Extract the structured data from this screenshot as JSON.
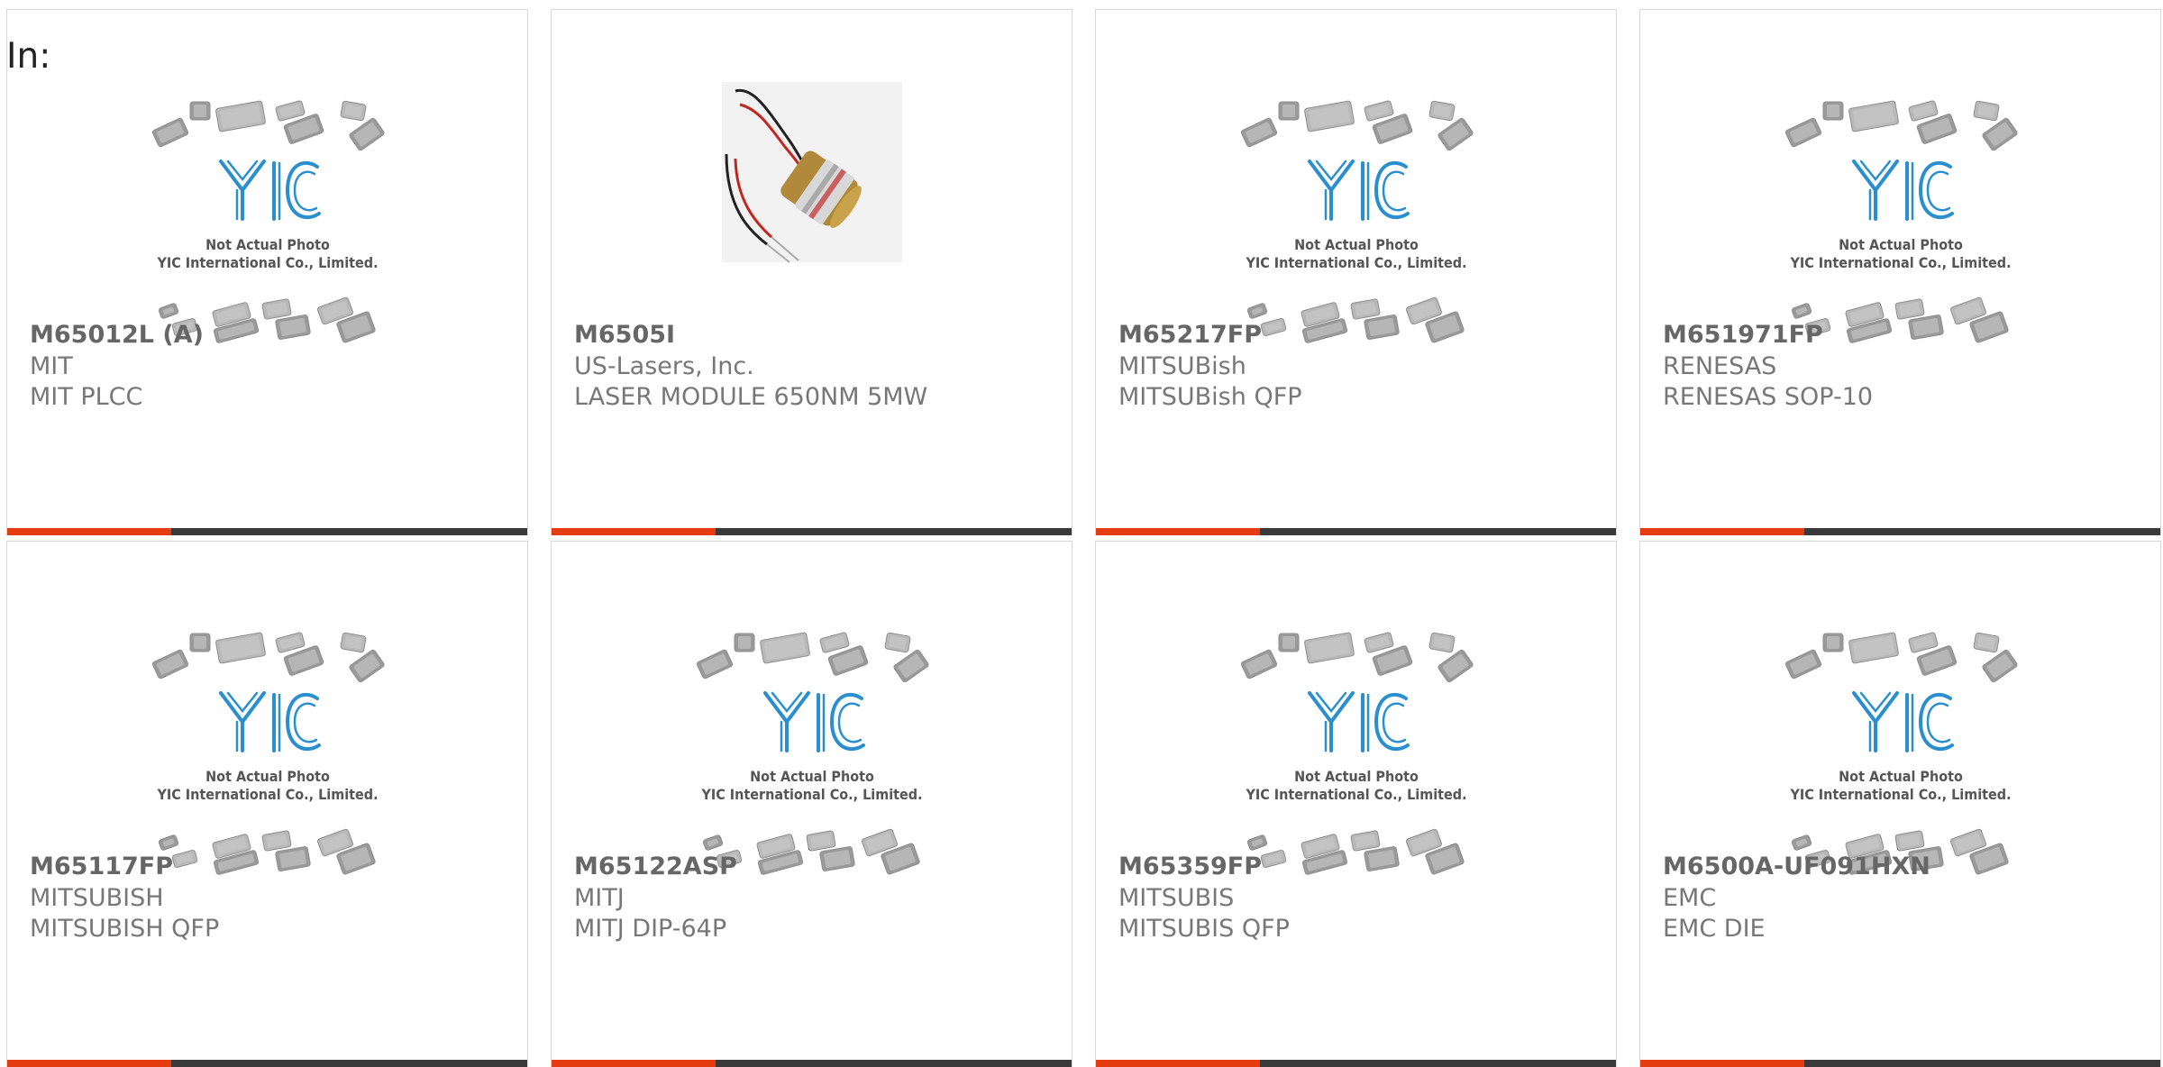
{
  "page": {
    "label": "In:"
  },
  "theme": {
    "accent": "#e63c11",
    "bar": "#3a3a3a",
    "logo_blue": "#2a8fd0"
  },
  "placeholder": {
    "line1": "Not Actual Photo",
    "line2": "YIC International Co., Limited.",
    "logo_text": "YIC"
  },
  "products": [
    {
      "part": "M65012L (A)",
      "manufacturer": "MIT",
      "description": "MIT PLCC",
      "image": "placeholder"
    },
    {
      "part": "M6505I",
      "manufacturer": "US-Lasers, Inc.",
      "description": "LASER MODULE 650NM 5MW",
      "image": "laser-module"
    },
    {
      "part": "M65217FP",
      "manufacturer": "MITSUBish",
      "description": "MITSUBish QFP",
      "image": "placeholder"
    },
    {
      "part": "M651971FP",
      "manufacturer": "RENESAS",
      "description": "RENESAS SOP-10",
      "image": "placeholder"
    },
    {
      "part": "M65117FP",
      "manufacturer": "MITSUBISH",
      "description": "MITSUBISH QFP",
      "image": "placeholder"
    },
    {
      "part": "M65122ASP",
      "manufacturer": "MITJ",
      "description": "MITJ DIP-64P",
      "image": "placeholder"
    },
    {
      "part": "M65359FP",
      "manufacturer": "MITSUBIS",
      "description": "MITSUBIS QFP",
      "image": "placeholder"
    },
    {
      "part": "M6500A-UF091HXN",
      "manufacturer": "EMC",
      "description": "EMC DIE",
      "image": "placeholder"
    }
  ]
}
